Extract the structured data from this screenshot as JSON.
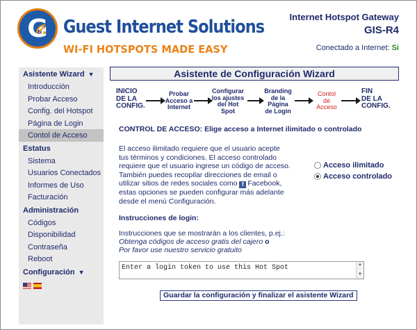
{
  "brand": {
    "name": "Guest Internet Solutions",
    "tagline": "WI-FI HOTSPOTS MADE EASY"
  },
  "header": {
    "product": "Internet Hotspot Gateway",
    "model": "GIS-R4",
    "connection_label": "Conectado a Internet:",
    "connection_value": "Si"
  },
  "sidebar": {
    "sections": [
      {
        "title": "Asistente Wizard",
        "chevron": "▼",
        "items": [
          "Introducción",
          "Probar Acceso",
          "Config. del Hotspot",
          "Página de Login",
          "Contol de Acceso"
        ]
      },
      {
        "title": "Estatus",
        "items": [
          "Sistema",
          "Usuarios Conectados",
          "Informes de Uso",
          "Facturación"
        ]
      },
      {
        "title": "Administración",
        "items": [
          "Códigos",
          "Disponibilidad",
          "Contraseña",
          "Reboot"
        ]
      },
      {
        "title": "Configuración",
        "chevron": "▼",
        "items": []
      }
    ],
    "active_item": "Contol de Acceso",
    "flags": [
      "flag-us-icon",
      "flag-es-icon"
    ]
  },
  "main": {
    "title": "Asistente de Configuración Wizard",
    "steps": [
      {
        "lines": [
          "INICIO",
          "DE LA",
          "CONFIG."
        ]
      },
      {
        "lines": [
          "Probar",
          "Acceso a",
          "Internet"
        ]
      },
      {
        "lines": [
          "Configurar",
          "los ajustes",
          "del Hot",
          "Spot"
        ]
      },
      {
        "lines": [
          "Branding",
          "de la",
          "Página",
          "de Login"
        ]
      },
      {
        "lines": [
          "Contol",
          "de",
          "Acceso"
        ]
      },
      {
        "lines": [
          "FIN",
          "DE LA",
          "CONFIG."
        ]
      }
    ],
    "current_step": 4,
    "section_title": "CONTROL DE ACCESO: Elige acceso a Internet ilimitado o controlado",
    "description_part1": "El acceso ilimitado requiere que el usuario acepte tus términos y condiciones. El acceso controlado requiere que el usuario ingrese un código de acceso. También puedes recopilar direcciones de email o utilizar sitios de redes sociales como",
    "facebook_icon": "facebook-icon",
    "description_part2": "Facebook, estas opciones se pueden configurar más adelante desde el menú Configuración.",
    "options": [
      {
        "label": "Acceso ilimitado",
        "selected": false
      },
      {
        "label": "Acceso controlado",
        "selected": true
      }
    ],
    "login_title": "Instrucciones de login:",
    "login_desc": "Instrucciones que se mostrarán a los clientes, p.ej.:",
    "login_example_1": "Obtenga códigos de acceso gratis del cajero",
    "login_example_or": "o",
    "login_example_2": "Por favor use nuestro servicio gratuito",
    "login_textarea_value": "Enter a login token to use this Hot Spot",
    "save_button": "Guardar la configuración y finalizar el asistente Wizard"
  }
}
